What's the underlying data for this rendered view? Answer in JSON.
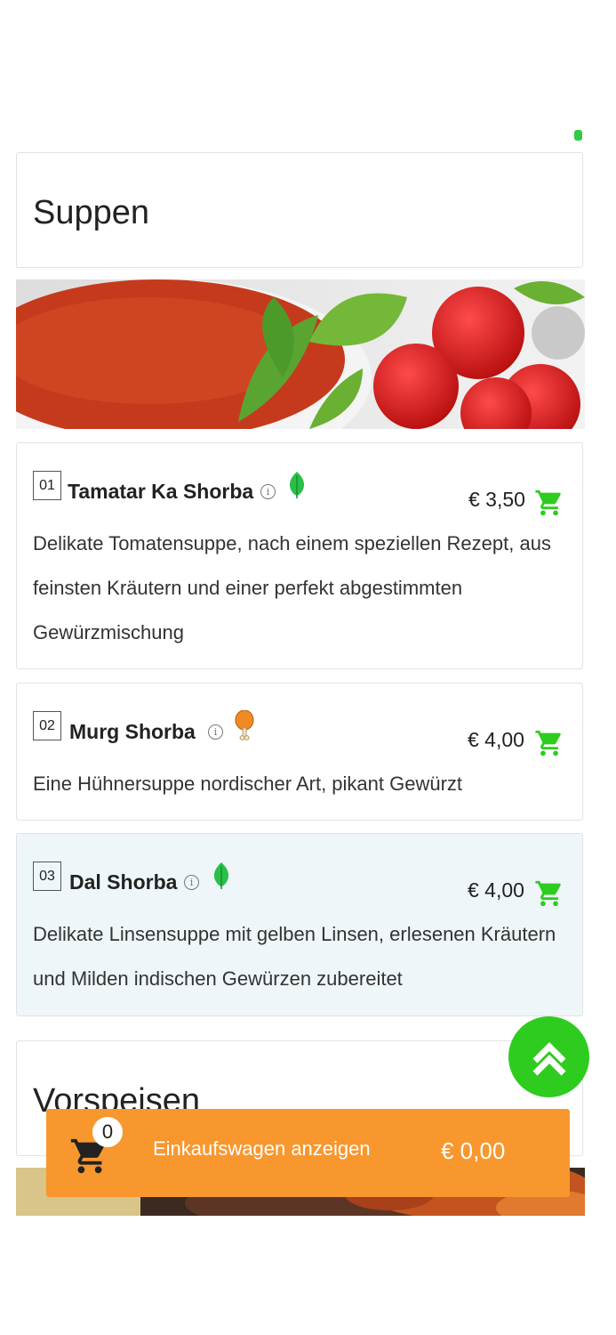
{
  "sections": [
    {
      "title": "Suppen"
    },
    {
      "title": "Vorspeisen"
    }
  ],
  "items": [
    {
      "number": "01",
      "name": "Tamatar Ka Shorba",
      "diet": "veg-leaf-icon",
      "price": "€ 3,50",
      "description": "Delikate Tomatensuppe, nach einem speziellen Rezept, aus feinsten Kräutern und einer perfekt abgestimmten Gewürzmischung"
    },
    {
      "number": "02",
      "name": "Murg Shorba",
      "diet": "chicken-leg-icon",
      "price": "€ 4,00",
      "description": "Eine Hühnersuppe nordischer Art, pikant Gewürzt"
    },
    {
      "number": "03",
      "name": "Dal Shorba",
      "diet": "veg-leaf-icon",
      "price": "€ 4,00",
      "description": "Delikate Linsensuppe mit gelben Linsen, erlesenen Kräutern und Milden indischen Gewürzen zubereitet"
    }
  ],
  "info_glyph": "i",
  "cart": {
    "count": "0",
    "label": "Einkaufswagen anzeigen",
    "total": "€ 0,00"
  },
  "colors": {
    "accent_green": "#2ecc1f",
    "cart_orange": "#f8972d",
    "highlight_row": "#eef6f9"
  }
}
